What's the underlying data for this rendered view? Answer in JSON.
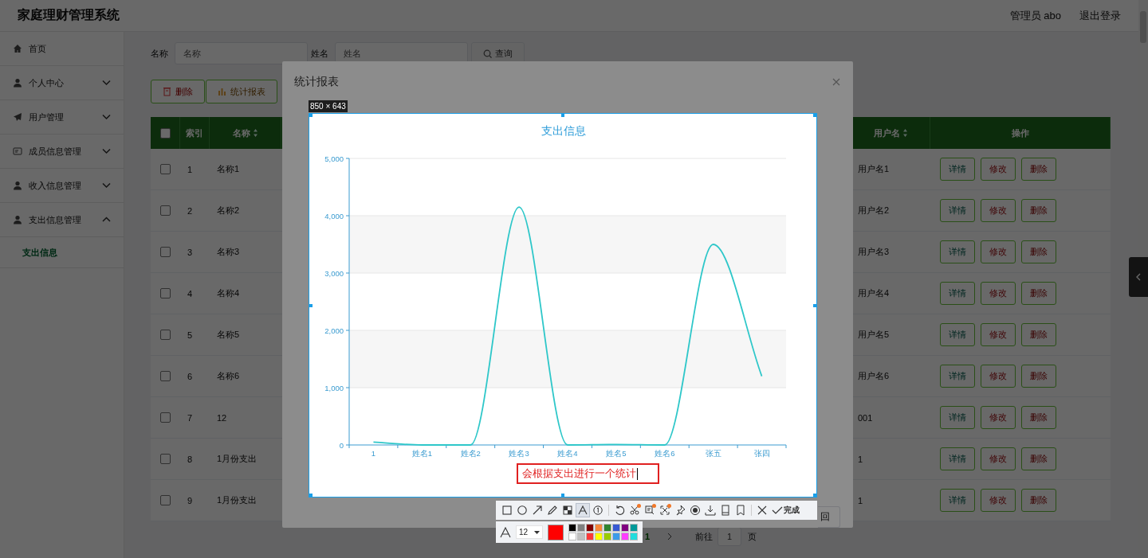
{
  "header": {
    "title": "家庭理财管理系统",
    "user": "管理员 abo",
    "logout": "退出登录"
  },
  "sidebar": {
    "items": [
      {
        "label": "首页",
        "kind": "link"
      },
      {
        "label": "个人中心",
        "kind": "submenu",
        "expanded": false
      },
      {
        "label": "用户管理",
        "kind": "submenu",
        "expanded": false
      },
      {
        "label": "成员信息管理",
        "kind": "submenu",
        "expanded": false
      },
      {
        "label": "收入信息管理",
        "kind": "submenu",
        "expanded": false
      },
      {
        "label": "支出信息管理",
        "kind": "submenu",
        "expanded": true,
        "children": [
          {
            "label": "支出信息",
            "selected": true
          }
        ]
      }
    ]
  },
  "search": {
    "fields": [
      {
        "label": "名称",
        "placeholder": "名称"
      },
      {
        "label": "姓名",
        "placeholder": "姓名"
      }
    ],
    "button": "查询"
  },
  "actions": [
    {
      "label": "删除",
      "kind": "danger"
    },
    {
      "label": "统计报表",
      "kind": "chart"
    }
  ],
  "table": {
    "all_checked": false,
    "columns": [
      {
        "label": "索引",
        "sortable": false
      },
      {
        "label": "名称",
        "sortable": true
      },
      {
        "label": "用户名",
        "sortable": true
      },
      {
        "label": "操作",
        "sortable": false
      }
    ],
    "rows": [
      {
        "checked": false,
        "index": "1",
        "name": "名称1",
        "username": "用户名1",
        "actions": [
          {
            "label": "详情",
            "kind": "view"
          },
          {
            "label": "修改",
            "kind": "edit"
          },
          {
            "label": "删除",
            "kind": "delete"
          }
        ]
      },
      {
        "checked": false,
        "index": "2",
        "name": "名称2",
        "username": "用户名2",
        "actions": [
          {
            "label": "详情",
            "kind": "view"
          },
          {
            "label": "修改",
            "kind": "edit"
          },
          {
            "label": "删除",
            "kind": "delete"
          }
        ]
      },
      {
        "checked": false,
        "index": "3",
        "name": "名称3",
        "username": "用户名3",
        "actions": [
          {
            "label": "详情",
            "kind": "view"
          },
          {
            "label": "修改",
            "kind": "edit"
          },
          {
            "label": "删除",
            "kind": "delete"
          }
        ]
      },
      {
        "checked": false,
        "index": "4",
        "name": "名称4",
        "username": "用户名4",
        "actions": [
          {
            "label": "详情",
            "kind": "view"
          },
          {
            "label": "修改",
            "kind": "edit"
          },
          {
            "label": "删除",
            "kind": "delete"
          }
        ]
      },
      {
        "checked": false,
        "index": "5",
        "name": "名称5",
        "username": "用户名5",
        "actions": [
          {
            "label": "详情",
            "kind": "view"
          },
          {
            "label": "修改",
            "kind": "edit"
          },
          {
            "label": "删除",
            "kind": "delete"
          }
        ]
      },
      {
        "checked": false,
        "index": "6",
        "name": "名称6",
        "username": "用户名6",
        "actions": [
          {
            "label": "详情",
            "kind": "view"
          },
          {
            "label": "修改",
            "kind": "edit"
          },
          {
            "label": "删除",
            "kind": "delete"
          }
        ]
      },
      {
        "checked": false,
        "index": "7",
        "name": "12",
        "username": "001",
        "actions": [
          {
            "label": "详情",
            "kind": "view"
          },
          {
            "label": "修改",
            "kind": "edit"
          },
          {
            "label": "删除",
            "kind": "delete"
          }
        ]
      },
      {
        "checked": false,
        "index": "8",
        "name": "1月份支出",
        "username": "1",
        "actions": [
          {
            "label": "详情",
            "kind": "view"
          },
          {
            "label": "修改",
            "kind": "edit"
          },
          {
            "label": "删除",
            "kind": "delete"
          }
        ]
      },
      {
        "checked": false,
        "index": "9",
        "name": "1月份支出",
        "username": "1",
        "actions": [
          {
            "label": "详情",
            "kind": "view"
          },
          {
            "label": "修改",
            "kind": "edit"
          },
          {
            "label": "删除",
            "kind": "delete"
          }
        ]
      }
    ]
  },
  "pagination": {
    "pages": [
      {
        "label": "1",
        "selected": true
      }
    ],
    "goto_label": "前往",
    "goto_value": "1",
    "goto_unit": "页"
  },
  "dialog": {
    "title": "统计报表",
    "footer_button": "回",
    "chart_data": {
      "type": "line",
      "title": "支出信息",
      "categories": [
        "1",
        "姓名1",
        "姓名2",
        "姓名3",
        "姓名4",
        "姓名5",
        "姓名6",
        "张五",
        "张四"
      ],
      "series": [
        {
          "color": "#2ec7c9",
          "values": [
            50,
            0,
            0,
            4150,
            0,
            10,
            0,
            3500,
            1200
          ]
        }
      ],
      "grid": true,
      "ylim": [
        0,
        5000
      ],
      "yticks": [
        {
          "value": 0,
          "label": "0"
        },
        {
          "value": 1000,
          "label": "1,000"
        },
        {
          "value": 2000,
          "label": "2,000"
        },
        {
          "value": 3000,
          "label": "3,000"
        },
        {
          "value": 4000,
          "label": "4,000"
        },
        {
          "value": 5000,
          "label": "5,000"
        }
      ]
    }
  },
  "snip": {
    "size_label": "850 × 643",
    "annotation": "会根据支出进行一个统计",
    "tool_groups": [
      [
        {
          "kind": "rect",
          "selected": false,
          "dot": false
        },
        {
          "kind": "ellipse",
          "selected": false,
          "dot": false
        },
        {
          "kind": "arrow",
          "selected": false,
          "dot": false
        },
        {
          "kind": "pencil",
          "selected": false,
          "dot": false
        },
        {
          "kind": "mosaic",
          "selected": false,
          "dot": false
        },
        {
          "kind": "text",
          "selected": true,
          "dot": false
        },
        {
          "kind": "serial",
          "selected": false,
          "dot": false
        }
      ],
      [
        {
          "kind": "undo",
          "selected": false,
          "dot": false
        },
        {
          "kind": "cut",
          "selected": false,
          "dot": true
        },
        {
          "kind": "ocr",
          "selected": false,
          "dot": true
        },
        {
          "kind": "scan",
          "selected": false,
          "dot": true
        },
        {
          "kind": "pin",
          "selected": false,
          "dot": false
        },
        {
          "kind": "record",
          "selected": false,
          "dot": false
        },
        {
          "kind": "download",
          "selected": false,
          "dot": false
        },
        {
          "kind": "save",
          "selected": false,
          "dot": false
        },
        {
          "kind": "bookmark",
          "selected": false,
          "dot": false
        }
      ],
      [
        {
          "kind": "close",
          "selected": false,
          "dot": false
        }
      ]
    ],
    "done_label": "完成",
    "font_size": "12",
    "current_swatch": {
      "color": "#ff0000"
    },
    "palette": [
      {
        "color": "#000000"
      },
      {
        "color": "#808080"
      },
      {
        "color": "#800000"
      },
      {
        "color": "#f7883a"
      },
      {
        "color": "#308430"
      },
      {
        "color": "#385ad3"
      },
      {
        "color": "#800080"
      },
      {
        "color": "#009999"
      },
      {
        "color": "#ffffff"
      },
      {
        "color": "#c0c0c0"
      },
      {
        "color": "#fb3838"
      },
      {
        "color": "#ffff00"
      },
      {
        "color": "#99cc00"
      },
      {
        "color": "#3d9be9"
      },
      {
        "color": "#ff3eff"
      },
      {
        "color": "#22dddd"
      }
    ]
  }
}
